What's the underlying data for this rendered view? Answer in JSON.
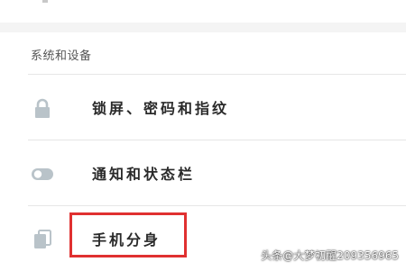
{
  "section": {
    "title": "系统和设备"
  },
  "items": [
    {
      "label": "锁屏、密码和指纹",
      "icon": "lock-icon"
    },
    {
      "label": "通知和状态栏",
      "icon": "toggle-icon"
    },
    {
      "label": "手机分身",
      "icon": "clone-icon"
    }
  ],
  "watermark": "头条@大梦初醒209356965",
  "colors": {
    "icon": "#b9c3c9",
    "highlight": "#e03030",
    "section_gap": "#f4f4f4"
  }
}
